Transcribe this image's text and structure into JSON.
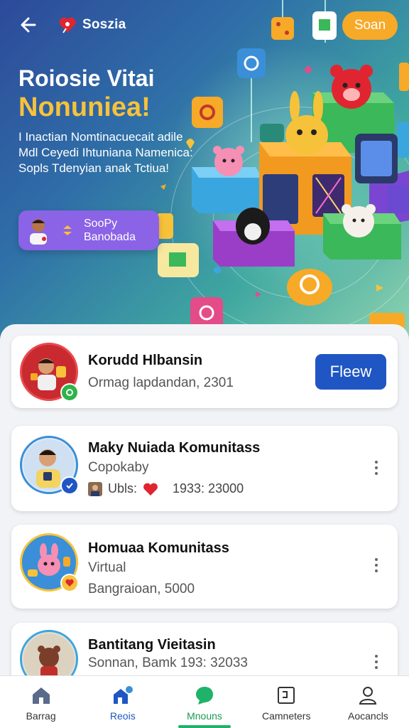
{
  "header": {
    "app_name": "Soszia",
    "top_button": "Soan"
  },
  "hero": {
    "title_line1": "Roiosie Vitai",
    "title_line2": "Nonuniea!",
    "description": "I Inactian Nomtinacuecait adile Mdl Ceyedi Ihtuniana Namenica: Sopls Tdenyian anak Tctiua!",
    "promo_line1": "SooPy",
    "promo_line2": "Banobada"
  },
  "cards": [
    {
      "name": "Korudd Hlbansin",
      "sub": "Ormag lapdandan, 2301",
      "button": "Fleew",
      "avatar_icon": "child-robot-avatar",
      "badge_color": "#2db34a"
    },
    {
      "name": "Maky Nuiada Komunitass",
      "sub": "Copokaby",
      "meta_label": "Ubls:",
      "meta_value": "1933: 23000",
      "avatar_icon": "man-avatar",
      "badge_color": "#1f56c3"
    },
    {
      "name": "Homuaa Komunitass",
      "sub": "Virtual",
      "meta_value": "Bangraioan, 5000",
      "avatar_icon": "pink-bunny-avatar",
      "badge_color": "#f7c23a"
    },
    {
      "name": "Bantitang Vieitasin",
      "sub": "Sonnan, Bamk 193: 32033",
      "avatar_icon": "bear-toy-avatar"
    }
  ],
  "nav": {
    "items": [
      {
        "label": "Barrag",
        "icon": "home-icon"
      },
      {
        "label": "Reois",
        "icon": "community-icon"
      },
      {
        "label": "Mnouns",
        "icon": "chat-bubble-icon"
      },
      {
        "label": "Camneters",
        "icon": "frame-icon"
      },
      {
        "label": "Aocancls",
        "icon": "profile-icon"
      }
    ]
  },
  "colors": {
    "accent_orange": "#f7a928",
    "accent_yellow": "#f7c23a",
    "primary_blue": "#1f56c3",
    "promo_purple": "#8b63e6",
    "nav_green": "#1fb36a"
  }
}
